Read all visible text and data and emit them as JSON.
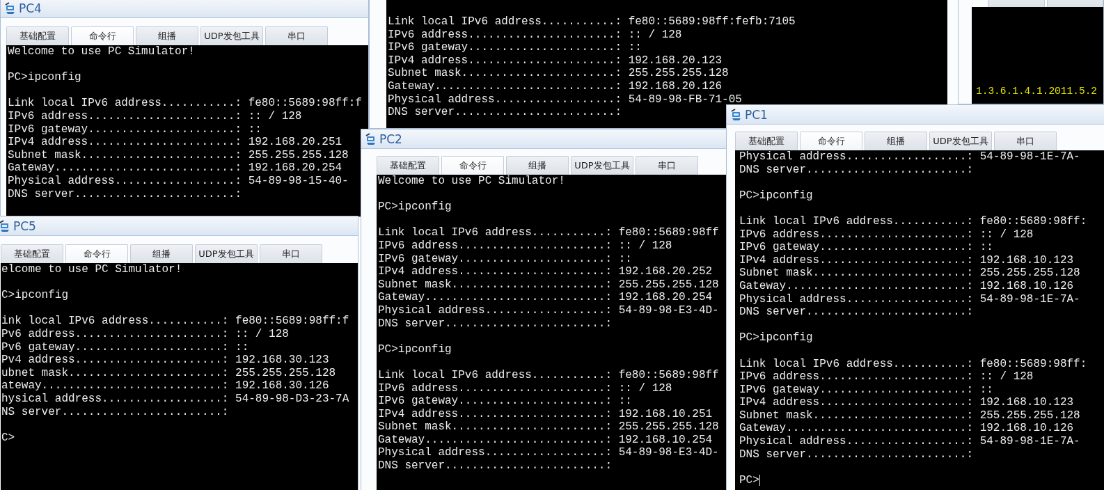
{
  "windows": [
    {
      "kind": "pc",
      "title": "PC4",
      "tabs": [
        {
          "label": "基础配置",
          "selected": false
        },
        {
          "label": "命令行",
          "selected": true
        },
        {
          "label": "组播",
          "selected": false
        },
        {
          "label": "UDP发包工具",
          "selected": false
        },
        {
          "label": "串口",
          "selected": false
        }
      ],
      "terminal": {
        "blocks": [
          [
            "Welcome to use PC Simulator!"
          ],
          [
            "PC>ipconfig"
          ],
          [
            "Link local IPv6 address...........: fe80::5689:98ff:f",
            "IPv6 address......................: :: / 128",
            "IPv6 gateway......................: ::",
            "IPv4 address......................: 192.168.20.251",
            "Subnet mask.......................: 255.255.255.128",
            "Gateway...........................: 192.168.20.254",
            "Physical address..................: 54-89-98-15-40-",
            "DNS server........................:"
          ]
        ]
      }
    },
    {
      "kind": "pc",
      "terminal": {
        "blocks": [
          [
            "Link local IPv6 address...........: fe80::5689:98ff:fefb:7105",
            "IPv6 address......................: :: / 128",
            "IPv6 gateway......................: ::",
            "IPv4 address......................: 192.168.20.123",
            "Subnet mask.......................: 255.255.255.128",
            "Gateway...........................: 192.168.20.126",
            "Physical address..................: 54-89-98-FB-71-05",
            "DNS server........................:"
          ]
        ]
      }
    },
    {
      "kind": "log",
      "tabs": [
        {
          "selected": false
        },
        {
          "selected": false
        }
      ],
      "terminal": {
        "blocks": [
          [
            "1.3.6.1.4.1.2011.5.2"
          ]
        ]
      }
    },
    {
      "kind": "pc",
      "title": "PC5",
      "tabs": [
        {
          "label": "基础配置",
          "selected": false
        },
        {
          "label": "命令行",
          "selected": true
        },
        {
          "label": "组播",
          "selected": false
        },
        {
          "label": "UDP发包工具",
          "selected": false
        },
        {
          "label": "串口",
          "selected": false
        }
      ],
      "terminal": {
        "blocks": [
          [
            "elcome to use PC Simulator!"
          ],
          [
            "C>ipconfig"
          ],
          [
            "ink local IPv6 address...........: fe80::5689:98ff:f",
            "Pv6 address......................: :: / 128",
            "Pv6 gateway......................: ::",
            "Pv4 address......................: 192.168.30.123",
            "ubnet mask.......................: 255.255.255.128",
            "ateway...........................: 192.168.30.126",
            "hysical address..................: 54-89-98-D3-23-7A",
            "NS server........................:"
          ],
          [
            "C>"
          ]
        ]
      }
    },
    {
      "kind": "pc",
      "title": "PC2",
      "tabs": [
        {
          "label": "基础配置",
          "selected": false
        },
        {
          "label": "命令行",
          "selected": true
        },
        {
          "label": "组播",
          "selected": false
        },
        {
          "label": "UDP发包工具",
          "selected": false
        },
        {
          "label": "串口",
          "selected": false
        }
      ],
      "terminal": {
        "blocks": [
          [
            "Welcome to use PC Simulator!"
          ],
          [
            "PC>ipconfig"
          ],
          [
            "Link local IPv6 address...........: fe80::5689:98ff",
            "IPv6 address......................: :: / 128",
            "IPv6 gateway......................: ::",
            "IPv4 address......................: 192.168.20.252",
            "Subnet mask.......................: 255.255.255.128",
            "Gateway...........................: 192.168.20.254",
            "Physical address..................: 54-89-98-E3-4D-",
            "DNS server........................:"
          ],
          [
            "PC>ipconfig"
          ],
          [
            "Link local IPv6 address...........: fe80::5689:98ff",
            "IPv6 address......................: :: / 128",
            "IPv6 gateway......................: ::",
            "IPv4 address......................: 192.168.10.251",
            "Subnet mask.......................: 255.255.255.128",
            "Gateway...........................: 192.168.10.254",
            "Physical address..................: 54-89-98-E3-4D-",
            "DNS server........................:"
          ]
        ]
      }
    },
    {
      "kind": "pc",
      "title": "PC1",
      "tabs": [
        {
          "label": "基础配置",
          "selected": false
        },
        {
          "label": "命令行",
          "selected": true
        },
        {
          "label": "组播",
          "selected": false
        },
        {
          "label": "UDP发包工具",
          "selected": false
        },
        {
          "label": "串口",
          "selected": false
        }
      ],
      "terminal": {
        "cursor": true,
        "blocks": [
          [
            "Physical address..................: 54-89-98-1E-7A-",
            "DNS server........................:"
          ],
          [
            "PC>ipconfig"
          ],
          [
            "Link local IPv6 address...........: fe80::5689:98ff:",
            "IPv6 address......................: :: / 128",
            "IPv6 gateway......................: ::",
            "IPv4 address......................: 192.168.10.123",
            "Subnet mask.......................: 255.255.255.128",
            "Gateway...........................: 192.168.10.126",
            "Physical address..................: 54-89-98-1E-7A-",
            "DNS server........................:"
          ],
          [
            "PC>ipconfig"
          ],
          [
            "Link local IPv6 address...........: fe80::5689:98ff:",
            "IPv6 address......................: :: / 128",
            "IPv6 gateway......................: ::",
            "IPv4 address......................: 192.168.10.123",
            "Subnet mask.......................: 255.255.255.128",
            "Gateway...........................: 192.168.10.126",
            "Physical address..................: 54-89-98-1E-7A-",
            "DNS server........................:"
          ],
          [
            "PC>"
          ]
        ]
      }
    }
  ]
}
